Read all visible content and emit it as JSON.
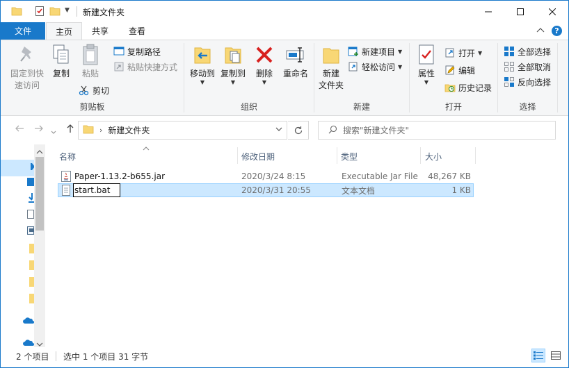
{
  "window": {
    "title": "新建文件夹",
    "controls": {
      "minimize": "—",
      "maximize": "☐",
      "close": "✕"
    }
  },
  "tabs": {
    "file": "文件",
    "home": "主页",
    "share": "共享",
    "view": "查看"
  },
  "ribbon": {
    "clipboard": {
      "label": "剪贴板",
      "pin_line1": "固定到快",
      "pin_line2": "速访问",
      "copy": "复制",
      "paste": "粘贴",
      "copy_path": "复制路径",
      "paste_shortcut": "粘贴快捷方式",
      "cut": "剪切"
    },
    "organize": {
      "label": "组织",
      "move_to": "移动到",
      "copy_to": "复制到",
      "delete": "删除",
      "rename": "重命名"
    },
    "new": {
      "label": "新建",
      "new_folder_line1": "新建",
      "new_folder_line2": "文件夹",
      "new_item": "新建项目",
      "easy_access": "轻松访问"
    },
    "open": {
      "label": "打开",
      "properties": "属性",
      "open": "打开",
      "edit": "编辑",
      "history": "历史记录"
    },
    "select": {
      "label": "选择",
      "select_all": "全部选择",
      "select_none": "全部取消",
      "invert": "反向选择"
    }
  },
  "address": {
    "path": "新建文件夹",
    "search_placeholder": "搜索\"新建文件夹\""
  },
  "columns": {
    "name": "名称",
    "date": "修改日期",
    "type": "类型",
    "size": "大小"
  },
  "files": [
    {
      "name": "Paper-1.13.2-b655.jar",
      "date": "2020/3/24 8:15",
      "type": "Executable Jar File",
      "size": "48,267 KB",
      "icon": "jar-file-icon"
    },
    {
      "name": "start.bat",
      "date": "2020/3/31 20:55",
      "type": "文本文档",
      "size": "1 KB",
      "icon": "text-file-icon",
      "renaming": true
    }
  ],
  "status": {
    "count": "2 个项目",
    "selection": "选中 1 个项目  31 字节"
  },
  "colors": {
    "accent": "#1979ca",
    "selection": "#cce8ff",
    "selection_border": "#99d1ff",
    "folder": "#f8d775",
    "delete_red": "#d8211f"
  }
}
